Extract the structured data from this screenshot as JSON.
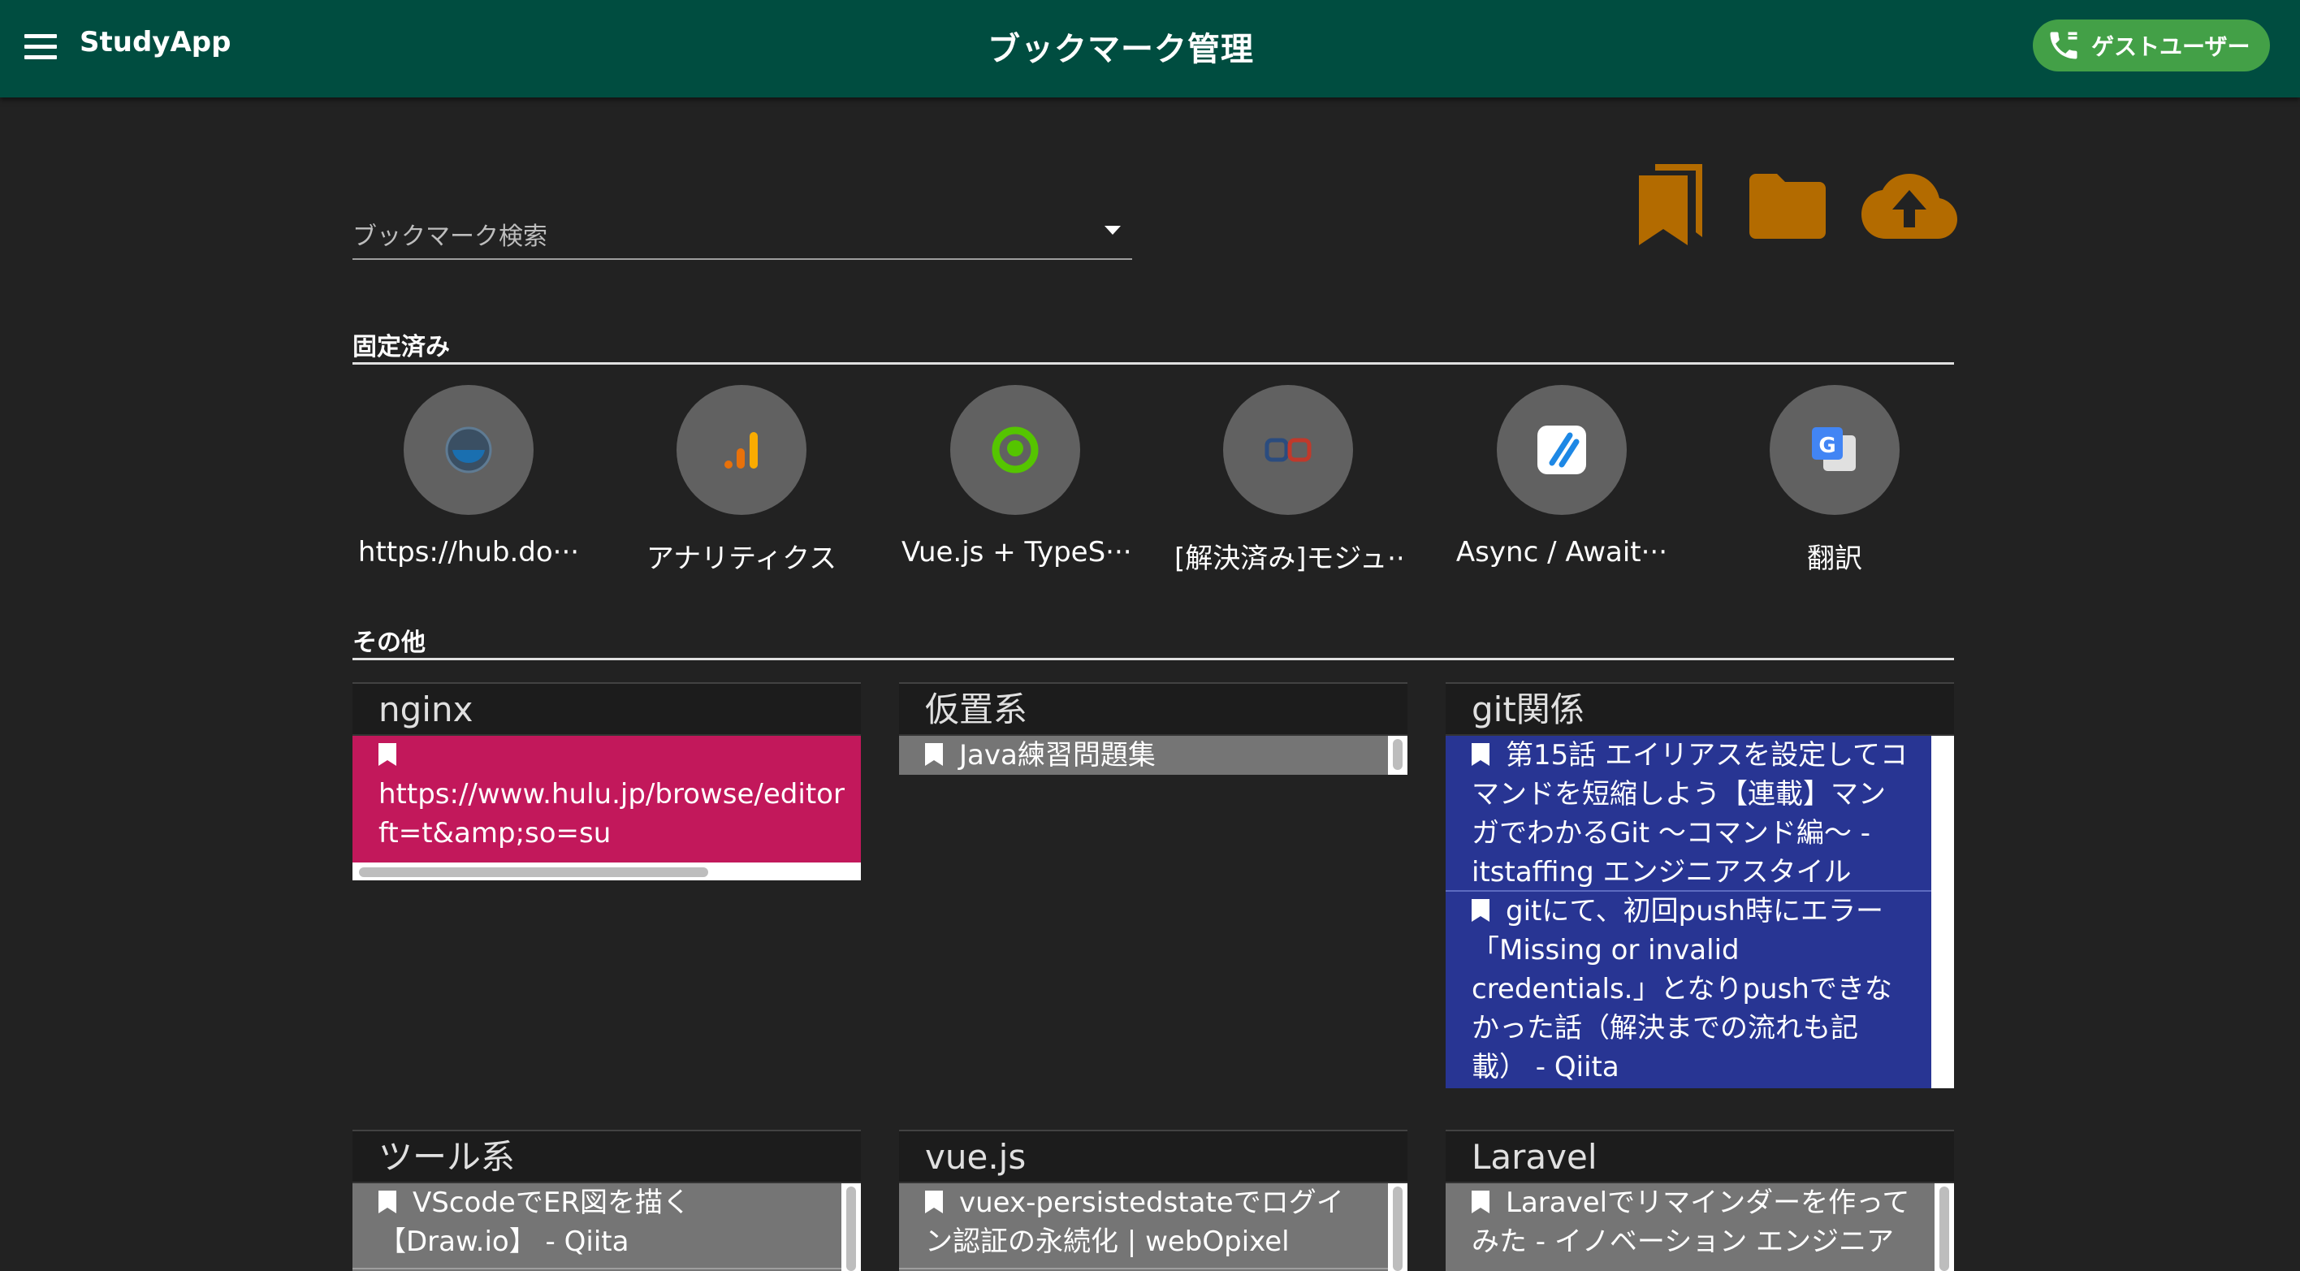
{
  "appbar": {
    "app_name": "StudyApp",
    "page_title": "ブックマーク管理",
    "user_label": "ゲストユーザー",
    "color": "#004d40"
  },
  "search": {
    "label": "ブックマーク検索"
  },
  "actions": [
    {
      "icon": "bookmarks-icon",
      "color": "#b36b00"
    },
    {
      "icon": "folder-icon",
      "color": "#b36b00"
    },
    {
      "icon": "cloud-upload-icon",
      "color": "#b36b00"
    }
  ],
  "sections": {
    "pinned": "固定済み",
    "other": "その他"
  },
  "pinned": [
    {
      "label": "https://hub.do···",
      "icon": "docker-icon"
    },
    {
      "label": "アナリティクス",
      "icon": "analytics-icon"
    },
    {
      "label": "Vue.js + TypeS···",
      "icon": "qiita-icon"
    },
    {
      "label": "[解決済み]モジュ···",
      "icon": "qa-icon"
    },
    {
      "label": "Async / Await···",
      "icon": "slash-icon"
    },
    {
      "label": "翻訳",
      "icon": "google-translate-icon"
    }
  ],
  "folders": [
    {
      "name": "nginx",
      "color": "#c2185b",
      "items": [
        "https://www.hulu.jp/browse/editor ft=t&amp;so=su"
      ]
    },
    {
      "name": "仮置系",
      "color": "#757575",
      "items": [
        "Java練習問題集"
      ]
    },
    {
      "name": "git関係",
      "color": "#283593",
      "items": [
        "第15話 エイリアスを設定してコマンドを短縮しよう【連載】マンガでわかるGit 〜コマンド編〜 - itstaffing エンジニアスタイル",
        "gitにて、初回push時にエラー「Missing or invalid credentials.」となりpushできなかった話（解決までの流れも記載） - Qiita"
      ]
    },
    {
      "name": "ツール系",
      "color": "#757575",
      "items": [
        "VScodeでER図を描く【Draw.io】 - Qiita"
      ]
    },
    {
      "name": "vue.js",
      "color": "#757575",
      "items": [
        "vuex-persistedstateでログイン認証の永続化 | webOpixel"
      ]
    },
    {
      "name": "Laravel",
      "color": "#757575",
      "items": [
        "Laravelでリマインダーを作ってみた - イノベーション エンジニア"
      ]
    }
  ]
}
